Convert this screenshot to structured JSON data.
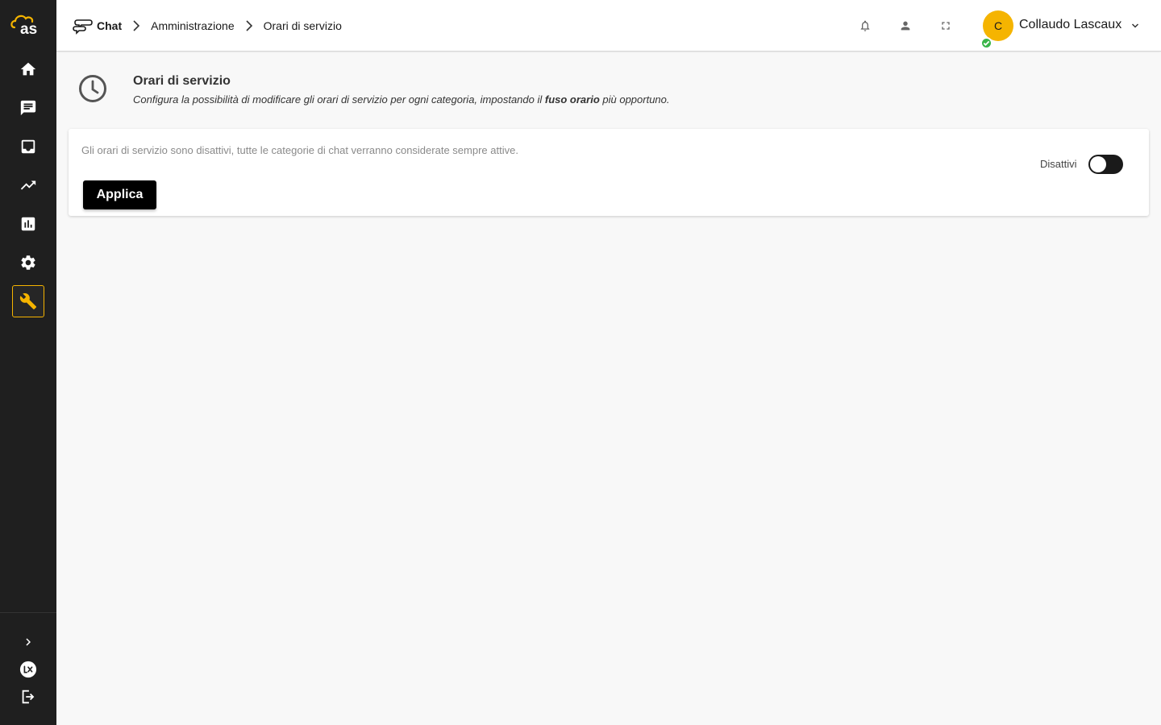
{
  "brand": {
    "logo_text": "as",
    "accent": "#f5b400",
    "sidebar_bg": "#1f1f1f"
  },
  "sidebar": {
    "items": [
      {
        "name": "home",
        "icon": "home-icon"
      },
      {
        "name": "chat",
        "icon": "chat-icon"
      },
      {
        "name": "inbox",
        "icon": "inbox-icon"
      },
      {
        "name": "trends",
        "icon": "trending-up-icon"
      },
      {
        "name": "reports",
        "icon": "bar-chart-icon"
      },
      {
        "name": "settings",
        "icon": "gear-icon"
      },
      {
        "name": "administration",
        "icon": "wrench-icon",
        "active": true
      }
    ],
    "bottom": [
      {
        "name": "expand",
        "icon": "chevron-right-icon"
      },
      {
        "name": "lascaux",
        "icon": "lx-logo-icon"
      },
      {
        "name": "logout",
        "icon": "logout-icon"
      }
    ]
  },
  "header": {
    "breadcrumb": [
      "Chat",
      "Amministrazione",
      "Orari di servizio"
    ],
    "icons": [
      "bell-icon",
      "person-icon",
      "fullscreen-icon"
    ],
    "user": {
      "initial": "C",
      "name": "Collaudo Lascaux",
      "status": "online"
    }
  },
  "page": {
    "title": "Orari di servizio",
    "subtitle_before": "Configura la possibilità di modificare gli orari di servizio per ogni categoria, impostando il ",
    "subtitle_bold": "fuso orario",
    "subtitle_after": " più opportuno."
  },
  "card": {
    "message": "Gli orari di servizio sono disattivi, tutte le categorie di chat verranno considerate sempre attive.",
    "apply_label": "Applica",
    "toggle_label": "Disattivi",
    "toggle_on": false
  }
}
